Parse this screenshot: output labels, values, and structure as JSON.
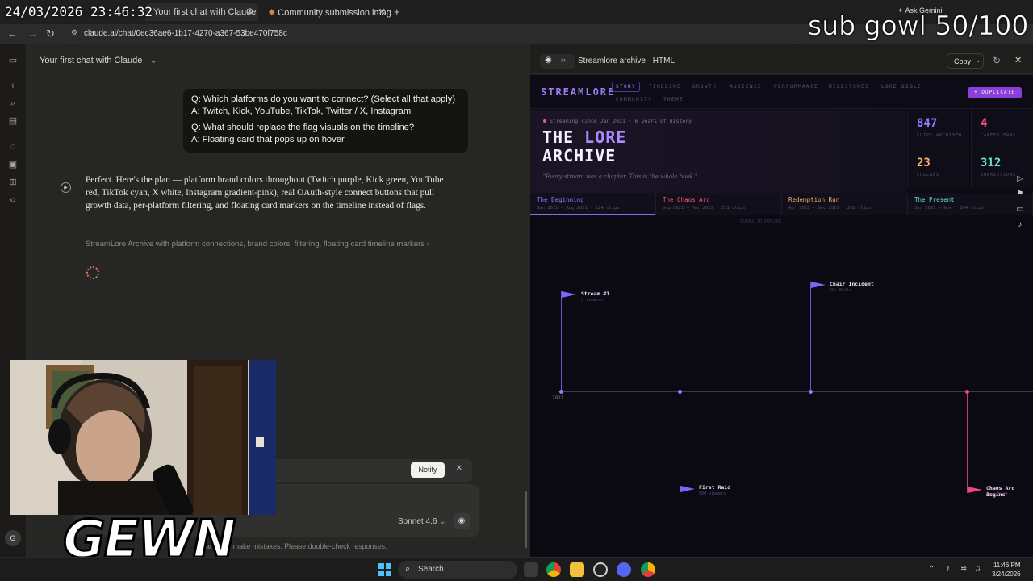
{
  "overlay": {
    "clock": "24/03/2026 23:46:32",
    "sub_goal": "sub gowl 50/100",
    "streamer_logo": "GEWN"
  },
  "browser": {
    "tabs": [
      {
        "label": "Your first chat with Claude - Cla",
        "active": true
      },
      {
        "label": "Community submission image",
        "active": false
      }
    ],
    "url": "claude.ai/chat/0ec36ae6-1b17-4270-a367-53be470f758c",
    "ask_gemini": "Ask Gemini"
  },
  "chat": {
    "title": "Your first chat with Claude",
    "user_message": {
      "q1": "Q: Which platforms do you want to connect? (Select all that apply)",
      "a1": "A: Twitch, Kick, YouTube, TikTok, Twitter / X, Instagram",
      "q2": "Q: What should replace the flag visuals on the timeline?",
      "a2": "A: Floating card that pops up on hover"
    },
    "assistant_text": "Perfect. Here's the plan — platform brand colors throughout (Twitch purple, Kick green, YouTube red, TikTok cyan, X white, Instagram gradient-pink), real OAuth-style connect buttons that pull growth data, per-platform filtering, and floating card markers on the timeline instead of flags.",
    "artifact_link": "StreamLore Archive with platform connections, brand colors, filtering, floating card timeline markers",
    "notify_label": "Notify",
    "model": "Sonnet 4.6",
    "disclaimer": "and can make mistakes. Please double-check responses.",
    "avatar_initial": "G"
  },
  "artifact": {
    "title": "Streamlore archive · HTML",
    "copy_label": "Copy"
  },
  "site": {
    "logo": "STREAMLORE",
    "nav": [
      "STORY",
      "TIMELINE",
      "GROWTH",
      "AUDIENCE",
      "PERFORMANCE",
      "MILESTONES",
      "LORE BIBLE",
      "COMMUNITY",
      "THEME"
    ],
    "duplicate_label": "+ DUPLICATE",
    "hero": {
      "eyebrow": "Streaming since Jan 2021 · 6 years of history",
      "title_a": "THE",
      "title_b": "LORE",
      "title_c": "ARCHIVE",
      "quote": "\"Every stream was a chapter. This is the whole book.\""
    },
    "stats": [
      {
        "value": "847",
        "label": "CLIPS ARCHIVED",
        "color": "#8f7cff"
      },
      {
        "value": "4",
        "label": "CAREER ERAS",
        "color": "#ff4f7b"
      },
      {
        "value": "23",
        "label": "COLLABS",
        "color": "#f4b266"
      },
      {
        "value": "312",
        "label": "SUBMISSIONS",
        "color": "#6fe0c4"
      }
    ],
    "eras": [
      {
        "title": "The Beginning",
        "sub": "Jan 2021 – Aug 2021 · 124 clips",
        "color": "#8f7cff"
      },
      {
        "title": "The Chaos Arc",
        "sub": "Sep 2021 – Mar 2022 · 231 clips",
        "color": "#ff4f7b"
      },
      {
        "title": "Redemption Run",
        "sub": "Apr 2022 – Dec 2022 · 298 clips",
        "color": "#f4b266"
      },
      {
        "title": "The Present",
        "sub": "Jan 2023 – Now · 194 clips",
        "color": "#6fe0c4"
      }
    ],
    "timeline": {
      "caption": "SCROLL TO EXPLORE",
      "year_label": "2021",
      "events": [
        {
          "title": "Stream #1",
          "sub": "3 viewers"
        },
        {
          "title": "Chair Incident",
          "sub": "50+ Bells"
        },
        {
          "title": "First Raid",
          "sub": "500 viewers"
        },
        {
          "title": "Chaos Arc Begins",
          "sub": "Era shift"
        }
      ]
    }
  },
  "taskbar": {
    "search_label": "Search",
    "time": "11:46 PM",
    "date": "3/24/2026"
  }
}
